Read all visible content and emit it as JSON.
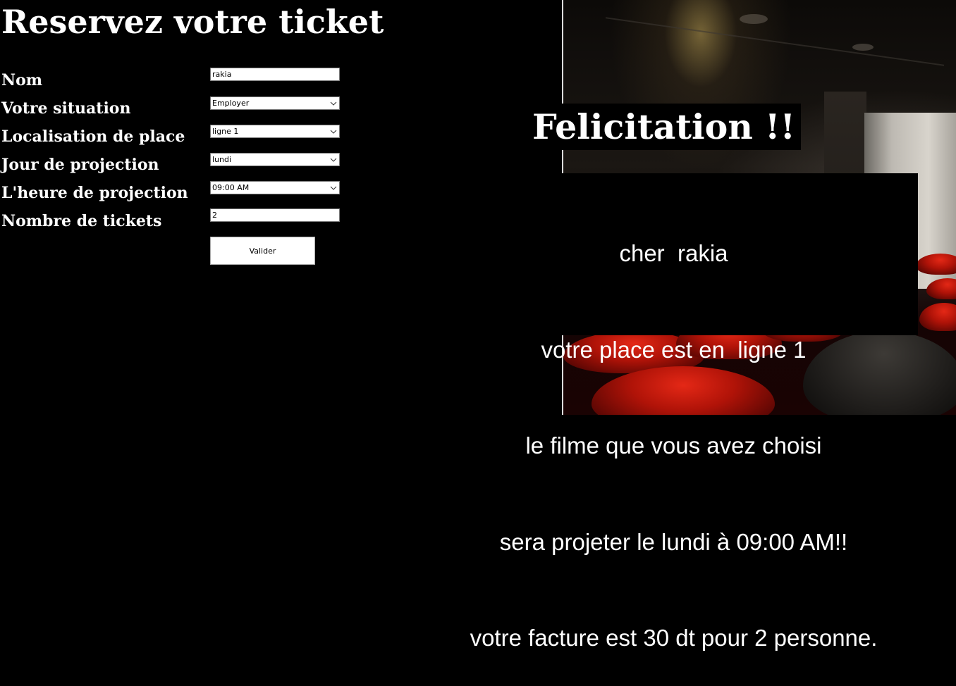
{
  "page": {
    "title": "Reservez votre ticket"
  },
  "form": {
    "labels": {
      "nom": "Nom",
      "situation": "Votre situation",
      "localisation": "Localisation de place",
      "jour": "Jour de projection",
      "heure": "L'heure de projection",
      "nombre": "Nombre de tickets"
    },
    "values": {
      "nom": "rakia",
      "situation": "Employer",
      "localisation": "ligne 1",
      "jour": "lundi",
      "heure": "09:00 AM",
      "nombre": "2"
    },
    "submit_label": "Valider"
  },
  "confirmation": {
    "heading": "Felicitation !!",
    "lines": [
      "cher  rakia",
      "votre place est en  ligne 1",
      "le filme que vous avez choisi",
      "sera projeter le lundi à 09:00 AM!!",
      "votre facture est 30 dt pour 2 personne."
    ]
  },
  "icons": {
    "dropdown": "chevron-down-icon"
  },
  "colors": {
    "background": "#000000",
    "text": "#ffffff",
    "seat_red": "#c4190a"
  }
}
